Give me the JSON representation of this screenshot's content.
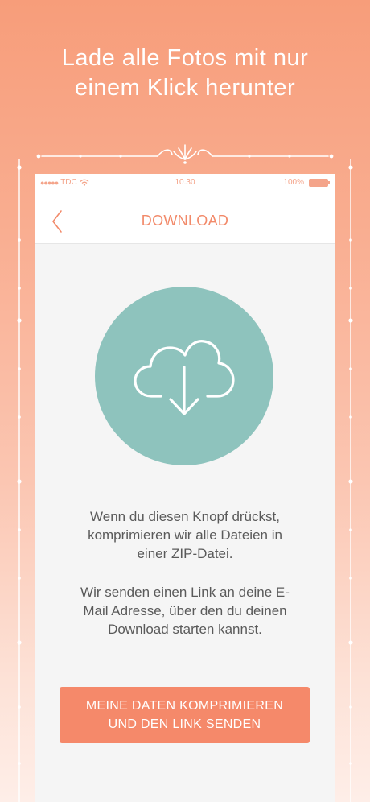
{
  "promo": {
    "headline": "Lade alle Fotos mit nur\neinem Klick herunter"
  },
  "status_bar": {
    "carrier": "TDC",
    "time": "10.30",
    "battery": "100%"
  },
  "nav": {
    "title": "DOWNLOAD",
    "back_icon": "chevron-left-icon"
  },
  "main": {
    "download_icon": "cloud-download-icon",
    "paragraph_1": "Wenn du diesen Knopf drückst,\nkomprimieren wir alle Dateien in\neiner ZIP-Datei.",
    "paragraph_2": "Wir senden einen Link an deine E-\nMail Adresse, über den du deinen\nDownload starten kannst.",
    "button_label": "MEINE DATEN KOMPRIMIEREN\nUND DEN LINK SENDEN"
  },
  "colors": {
    "accent": "#f5896a",
    "circle": "#8ec3bd",
    "text": "#5a5a5a"
  }
}
